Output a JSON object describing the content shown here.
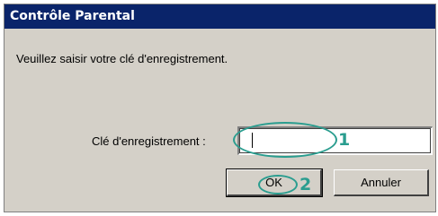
{
  "window": {
    "title": "Contrôle Parental"
  },
  "prompt": "Veuillez saisir votre clé d'enregistrement.",
  "registration": {
    "label": "Clé d'enregistrement :",
    "value": ""
  },
  "buttons": {
    "ok_label": "OK",
    "cancel_label": "Annuler"
  },
  "annotations": {
    "marker_1": "1",
    "marker_2": "2",
    "color": "#2a9d8f"
  },
  "colors": {
    "title_bar": "#0a246a",
    "dialog_bg": "#d4d0c8"
  }
}
